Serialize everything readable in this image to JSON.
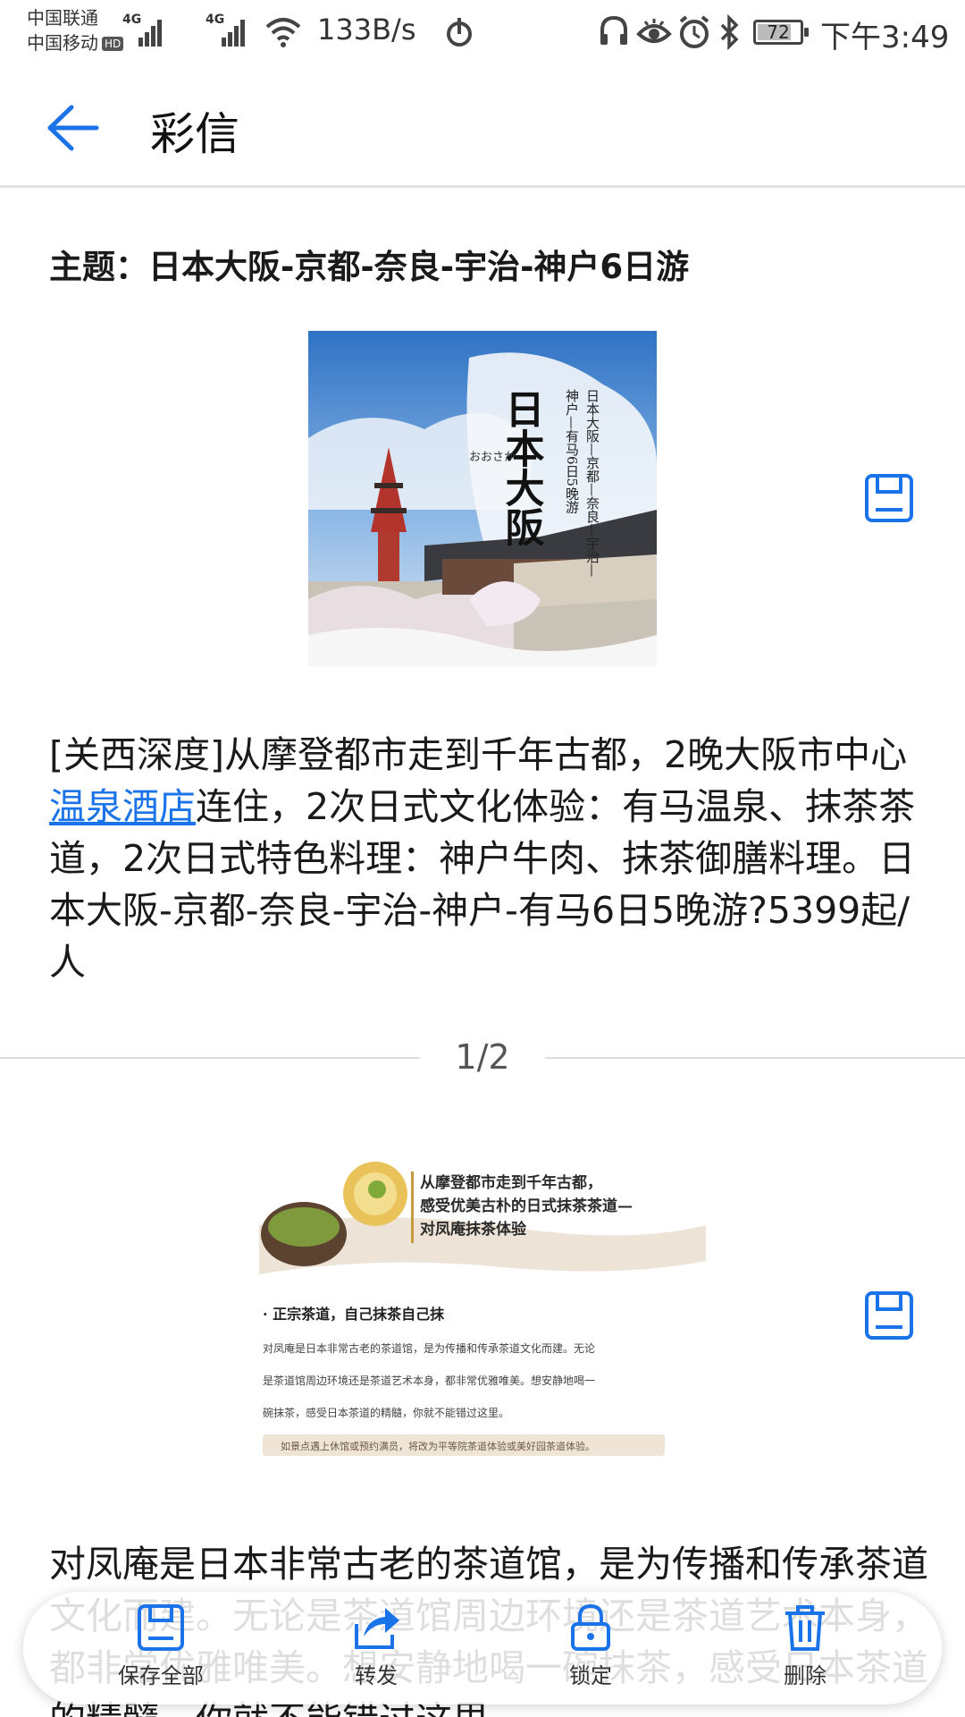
{
  "status_bar": {
    "carrier_1": "中国联通",
    "carrier_2": "中国移动",
    "hd_badge": "HD",
    "signal_1_label": "4G",
    "signal_2_label": "4G",
    "net_speed": "133B/s",
    "battery_level": "72",
    "time": "下午3:49",
    "icons": [
      "signal-icon",
      "wifi-icon",
      "nfc-icon",
      "headset-icon",
      "eye-comfort-icon",
      "alarm-icon",
      "bluetooth-icon",
      "battery-icon"
    ]
  },
  "app_bar": {
    "back_icon": "arrow-left-icon",
    "title": "彩信"
  },
  "message": {
    "subject": "主题：日本大阪-京都-奈良-宇治-神户6日游",
    "image_1": {
      "title": "日本大阪",
      "subtitle_1": "神户—有马6日5晚游",
      "subtitle_2": "日本大阪—京都—奈良—宇治—",
      "signature": "おおさか"
    },
    "text_1_before_link": "[关西深度]从摩登都市走到千年古都，2晚大阪市中心",
    "text_1_link": "温泉酒店",
    "text_1_after_link": "连住，2次日式文化体验：有马温泉、抹茶茶道，2次日式特色料理：神户牛肉、抹茶御膳料理。日本大阪-京都-奈良-宇治-神户-有马6日5晚游?5399起/人",
    "page_indicator": "1/2",
    "image_2": {
      "heading_1": "从摩登都市走到千年古都，",
      "heading_2": "感受优美古朴的日式抹茶茶道—",
      "heading_3": "对凤庵抹茶体验",
      "bullet": "· 正宗茶道，自己抹茶自己抹",
      "para_1": "对凤庵是日本非常古老的茶道馆，是为传播和传承茶道文化而建。无论",
      "para_2": "是茶道馆周边环境还是茶道艺术本身，都非常优雅唯美。想安静地喝一",
      "para_3": "碗抹茶，感受日本茶道的精髓，你就不能错过这里。",
      "note": "如景点遇上休馆或预约满员，将改为平等院茶道体验或美好园茶道体验。"
    },
    "text_2": "对凤庵是日本非常古老的茶道馆，是为传播和传承茶道文化而建。无论是茶道馆周边环境还是茶道艺术本身，都非常优雅唯美。想安静地喝一碗抹茶，感受日本茶道的精髓，你就不能错过这里。"
  },
  "actions": [
    {
      "label": "保存全部",
      "icon": "save-all-icon"
    },
    {
      "label": "转发",
      "icon": "forward-icon"
    },
    {
      "label": "锁定",
      "icon": "lock-icon"
    },
    {
      "label": "删除",
      "icon": "trash-icon"
    }
  ],
  "colors": {
    "accent": "#1a73e8",
    "text": "#1a1a1a",
    "divider": "#dcdcdc"
  }
}
